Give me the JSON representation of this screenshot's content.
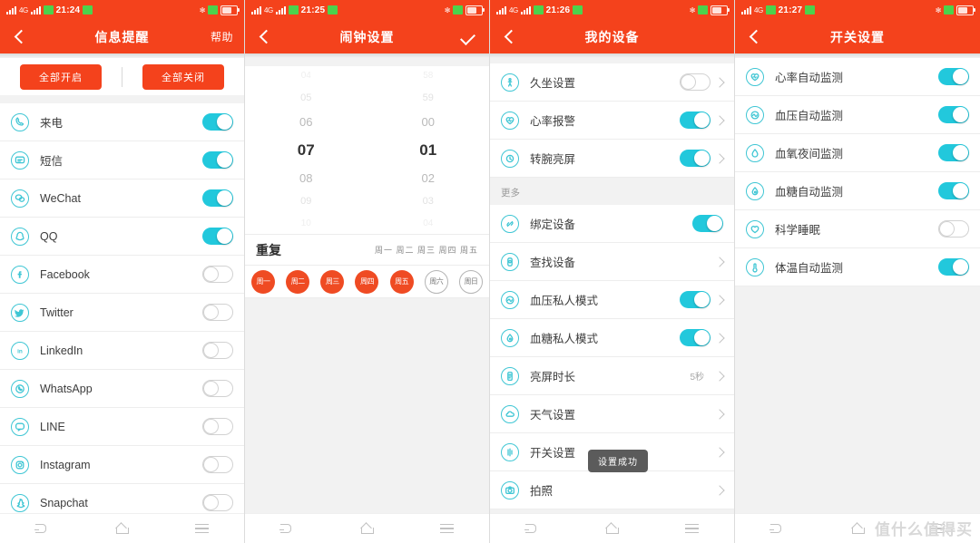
{
  "colors": {
    "header_red": "#f4421c",
    "switch_on": "#22c8dc",
    "icon_cyan": "#3fc6d4",
    "chip_selected": "#ef4b23",
    "toast_bg": "#5b5b5b"
  },
  "navbar": {
    "back_label": "back",
    "home_label": "home",
    "menu_label": "menu"
  },
  "watermark": "值什么值得买",
  "panels": [
    {
      "id": "message-reminder",
      "status": {
        "time": "21:24",
        "carrier_glyph": "4G"
      },
      "header": {
        "title": "信息提醒",
        "action": "帮助"
      },
      "bulk": {
        "enable_all": "全部开启",
        "disable_all": "全部关闭"
      },
      "items": [
        {
          "label": "来电",
          "icon": "phone-icon",
          "state": "on"
        },
        {
          "label": "短信",
          "icon": "sms-icon",
          "state": "on"
        },
        {
          "label": "WeChat",
          "icon": "wechat-icon",
          "state": "on"
        },
        {
          "label": "QQ",
          "icon": "qq-icon",
          "state": "on"
        },
        {
          "label": "Facebook",
          "icon": "facebook-icon",
          "state": "off"
        },
        {
          "label": "Twitter",
          "icon": "twitter-icon",
          "state": "off"
        },
        {
          "label": "LinkedIn",
          "icon": "linkedin-icon",
          "state": "off"
        },
        {
          "label": "WhatsApp",
          "icon": "whatsapp-icon",
          "state": "off"
        },
        {
          "label": "LINE",
          "icon": "line-icon",
          "state": "off"
        },
        {
          "label": "Instagram",
          "icon": "instagram-icon",
          "state": "off"
        },
        {
          "label": "Snapchat",
          "icon": "snapchat-icon",
          "state": "off"
        }
      ]
    },
    {
      "id": "alarm-settings",
      "status": {
        "time": "21:25",
        "carrier_glyph": "4G"
      },
      "header": {
        "title": "闹钟设置",
        "action": "confirm-check"
      },
      "picker": {
        "hours": [
          "04",
          "05",
          "06",
          "07",
          "08",
          "09",
          "10"
        ],
        "minutes": [
          "58",
          "59",
          "00",
          "01",
          "02",
          "03",
          "04"
        ],
        "selected_hour": "07",
        "selected_minute": "01"
      },
      "repeat": {
        "title": "重复",
        "summary": "周一 周二 周三 周四 周五",
        "chips": [
          {
            "label": "周一",
            "selected": true
          },
          {
            "label": "周二",
            "selected": true
          },
          {
            "label": "周三",
            "selected": true
          },
          {
            "label": "周四",
            "selected": true
          },
          {
            "label": "周五",
            "selected": true
          },
          {
            "label": "周六",
            "selected": false
          },
          {
            "label": "周日",
            "selected": false
          }
        ]
      }
    },
    {
      "id": "my-device",
      "status": {
        "time": "21:26",
        "carrier_glyph": "4G"
      },
      "header": {
        "title": "我的设备",
        "action": ""
      },
      "section_more": "更多",
      "items_top": [
        {
          "label": "久坐设置",
          "icon": "sedentary-icon",
          "state": "off",
          "chevron": true
        },
        {
          "label": "心率报警",
          "icon": "heart-rate-icon",
          "state": "on",
          "chevron": true
        },
        {
          "label": "转腕亮屏",
          "icon": "wrist-raise-icon",
          "state": "on",
          "chevron": true
        }
      ],
      "items_more": [
        {
          "label": "绑定设备",
          "icon": "bind-device-icon",
          "state": "on",
          "chevron": false
        },
        {
          "label": "查找设备",
          "icon": "find-device-icon",
          "state": "none",
          "chevron": true
        },
        {
          "label": "血压私人模式",
          "icon": "blood-pressure-icon",
          "state": "on",
          "chevron": true
        },
        {
          "label": "血糖私人模式",
          "icon": "blood-sugar-icon",
          "state": "on",
          "chevron": true
        },
        {
          "label": "亮屏时长",
          "icon": "screen-time-icon",
          "state": "none",
          "chevron": true,
          "value": "5秒"
        },
        {
          "label": "天气设置",
          "icon": "weather-icon",
          "state": "none",
          "chevron": true
        },
        {
          "label": "开关设置",
          "icon": "switch-settings-icon",
          "state": "none",
          "chevron": true
        },
        {
          "label": "拍照",
          "icon": "camera-icon",
          "state": "none",
          "chevron": true
        }
      ],
      "toast": "设置成功"
    },
    {
      "id": "switch-settings",
      "status": {
        "time": "21:27",
        "carrier_glyph": "4G"
      },
      "header": {
        "title": "开关设置",
        "action": ""
      },
      "items": [
        {
          "label": "心率自动监测",
          "icon": "heart-rate-icon",
          "state": "on"
        },
        {
          "label": "血压自动监测",
          "icon": "blood-pressure-icon",
          "state": "on"
        },
        {
          "label": "血氧夜间监测",
          "icon": "spo2-icon",
          "state": "on"
        },
        {
          "label": "血糖自动监测",
          "icon": "blood-sugar-icon",
          "state": "on"
        },
        {
          "label": "科学睡眠",
          "icon": "sleep-icon",
          "state": "off"
        },
        {
          "label": "体温自动监测",
          "icon": "temperature-icon",
          "state": "on"
        }
      ]
    }
  ]
}
